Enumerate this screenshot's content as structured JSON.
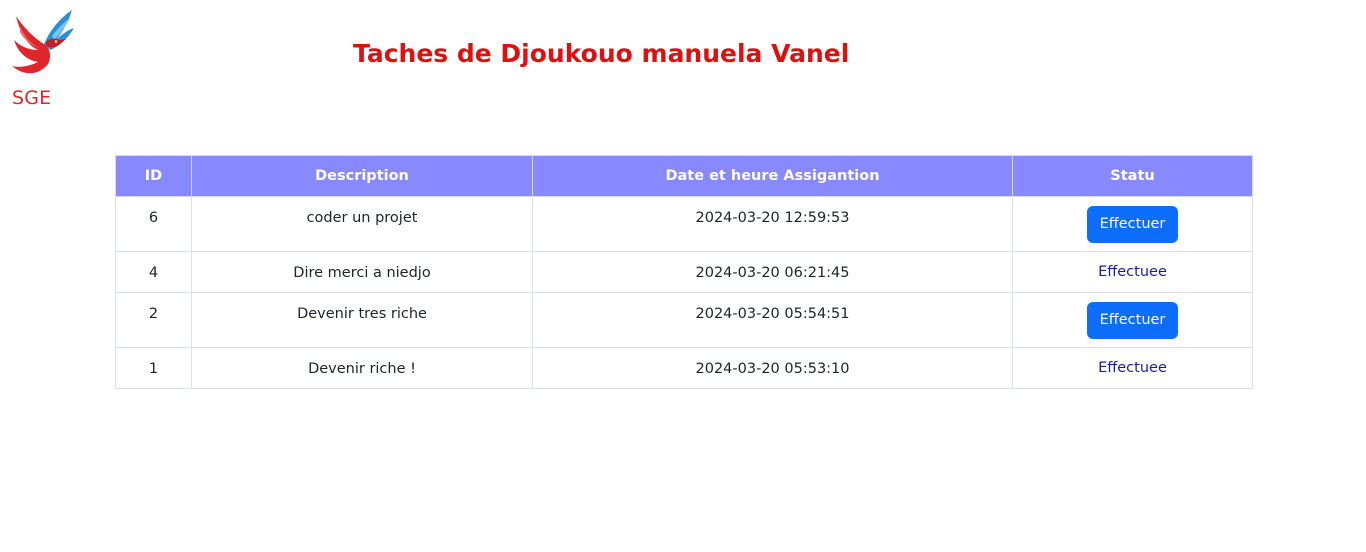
{
  "brand": {
    "name": "SGE",
    "logo_icon": "bird-logo-icon",
    "colors": {
      "red": "#e0262b",
      "blue": "#2a8fd6"
    }
  },
  "header": {
    "title": "Taches de Djoukouo manuela Vanel",
    "title_color": "#e01010"
  },
  "table": {
    "header_bg": "#8888ff",
    "columns": [
      "ID",
      "Description",
      "Date et heure Assigantion",
      "Statu"
    ],
    "rows": [
      {
        "id": "6",
        "description": "coder un projet",
        "datetime": "2024-03-20 12:59:53",
        "statu": "Effectuer",
        "statu_type": "button"
      },
      {
        "id": "4",
        "description": "Dire merci a niedjo",
        "datetime": "2024-03-20 06:21:45",
        "statu": "Effectuee",
        "statu_type": "link"
      },
      {
        "id": "2",
        "description": "Devenir tres riche",
        "datetime": "2024-03-20 05:54:51",
        "statu": "Effectuer",
        "statu_type": "button"
      },
      {
        "id": "1",
        "description": "Devenir riche !",
        "datetime": "2024-03-20 05:53:10",
        "statu": "Effectuee",
        "statu_type": "link"
      }
    ]
  },
  "colors": {
    "button_bg": "#0d6efd",
    "link": "#1a1aa8"
  }
}
